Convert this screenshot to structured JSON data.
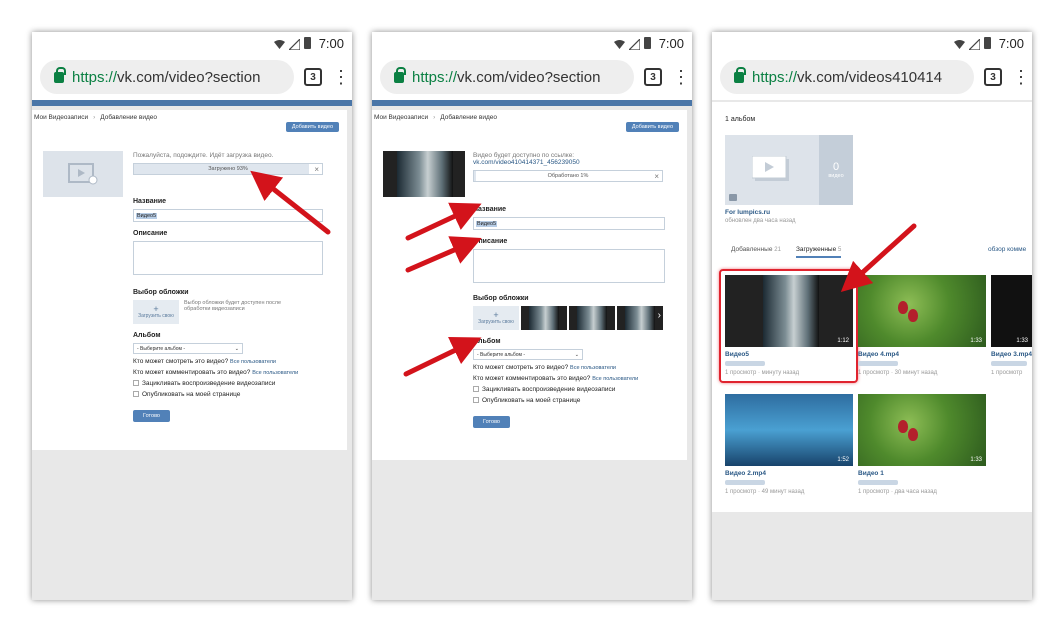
{
  "status": {
    "time": "7:00"
  },
  "phone1": {
    "url_proto": "https://",
    "url_rest": "vk.com/video?section",
    "tabs_count": "3",
    "breadcrumb_1": "Мои Видеозаписи",
    "breadcrumb_2": "Добавление видео",
    "add_button": "Добавить видео",
    "wait_text": "Пожалуйста, подождите. Идёт загрузка видео.",
    "progress_text": "Загружено 93%",
    "progress_value": 0.93,
    "name_label": "Название",
    "name_value": "Видео5",
    "desc_label": "Описание",
    "cover_label": "Выбор обложки",
    "cover_upload": "Загрузить свою",
    "cover_note": "Выбор обложки будет доступен после обработки видеозаписи",
    "album_label": "Альбом",
    "album_select": "- Выберите альбом -",
    "who_view": "Кто может смотреть это видео?",
    "who_view_value": "Все пользователи",
    "who_comment": "Кто может комментировать это видео?",
    "who_comment_value": "Все пользователи",
    "loop": "Зацикливать воспроизведение видеозаписи",
    "publish": "Опубликовать на моей странице",
    "done": "Готово"
  },
  "phone2": {
    "url_proto": "https://",
    "url_rest": "vk.com/video?section",
    "tabs_count": "3",
    "breadcrumb_1": "Мои Видеозаписи",
    "breadcrumb_2": "Добавление видео",
    "add_button": "Добавить видео",
    "link_text": "Видео будет доступно по ссылке:",
    "link_url": "vk.com/video410414371_456239050",
    "progress_text": "Обработано 1%",
    "progress_value": 0.01,
    "name_label": "Название",
    "name_value": "Видео5",
    "desc_label": "Описание",
    "cover_label": "Выбор обложки",
    "cover_upload": "Загрузить свою",
    "album_label": "Альбом",
    "album_select": "- Выберите альбом -",
    "who_view": "Кто может смотреть это видео?",
    "who_view_value": "Все пользователи",
    "who_comment": "Кто может комментировать это видео?",
    "who_comment_value": "Все пользователи",
    "loop": "Зацикливать воспроизведение видеозаписи",
    "publish": "Опубликовать на моей странице",
    "done": "Готово"
  },
  "phone3": {
    "url_proto": "https://",
    "url_rest": "vk.com/videos410414",
    "tabs_count": "3",
    "albums_count": "1 альбом",
    "album_count_num": "0",
    "album_count_word": "видео",
    "album_name": "For lumpics.ru",
    "album_updated": "обновлен два часа назад",
    "tab_added": "Добавленные",
    "tab_added_count": "21",
    "tab_uploaded": "Загруженные",
    "tab_uploaded_count": "5",
    "overview": "обзор комме",
    "videos": [
      {
        "title": "Видео5",
        "meta": "1 просмотр · минуту назад",
        "duration": "1:12"
      },
      {
        "title": "Видео 4.mp4",
        "meta": "1 просмотр · 30 минут назад",
        "duration": "1:33"
      },
      {
        "title": "Видео 3.mp4",
        "meta": "1 просмотр",
        "duration": "1:33"
      },
      {
        "title": "Видео 2.mp4",
        "meta": "1 просмотр · 49 минут назад",
        "duration": "1:52"
      },
      {
        "title": "Видео 1",
        "meta": "1 просмотр · два часа назад",
        "duration": "1:33"
      }
    ]
  },
  "colors": {
    "vk_blue": "#5181b8",
    "arrow_red": "#d3131b",
    "highlight": "#e0232e",
    "secure_green": "#0b8043"
  }
}
